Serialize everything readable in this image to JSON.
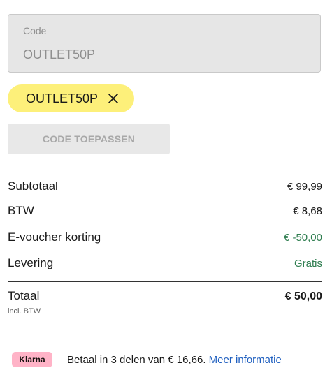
{
  "code_field": {
    "label": "Code",
    "value": "OUTLET50P"
  },
  "applied_code": {
    "label": "OUTLET50P",
    "remove_icon": "close-icon"
  },
  "apply_button": {
    "label": "CODE TOEPASSEN"
  },
  "summary": {
    "subtotal": {
      "label": "Subtotaal",
      "value": "€ 99,99"
    },
    "vat": {
      "label": "BTW",
      "value": "€ 8,68"
    },
    "voucher": {
      "label": "E-voucher korting",
      "value": "€ -50,00"
    },
    "delivery": {
      "label": "Levering",
      "value": "Gratis"
    },
    "total": {
      "label": "Totaal",
      "sublabel": "incl. BTW",
      "value": "€ 50,00"
    }
  },
  "klarna": {
    "badge": "Klarna",
    "text": "Betaal in 3 delen van € 16,66. ",
    "link": "Meer informatie"
  },
  "colors": {
    "chip": "#fdf07a",
    "discount_green": "#2e7d4f",
    "link_blue": "#1f5fbf",
    "klarna_pink": "#ffb3c7"
  }
}
